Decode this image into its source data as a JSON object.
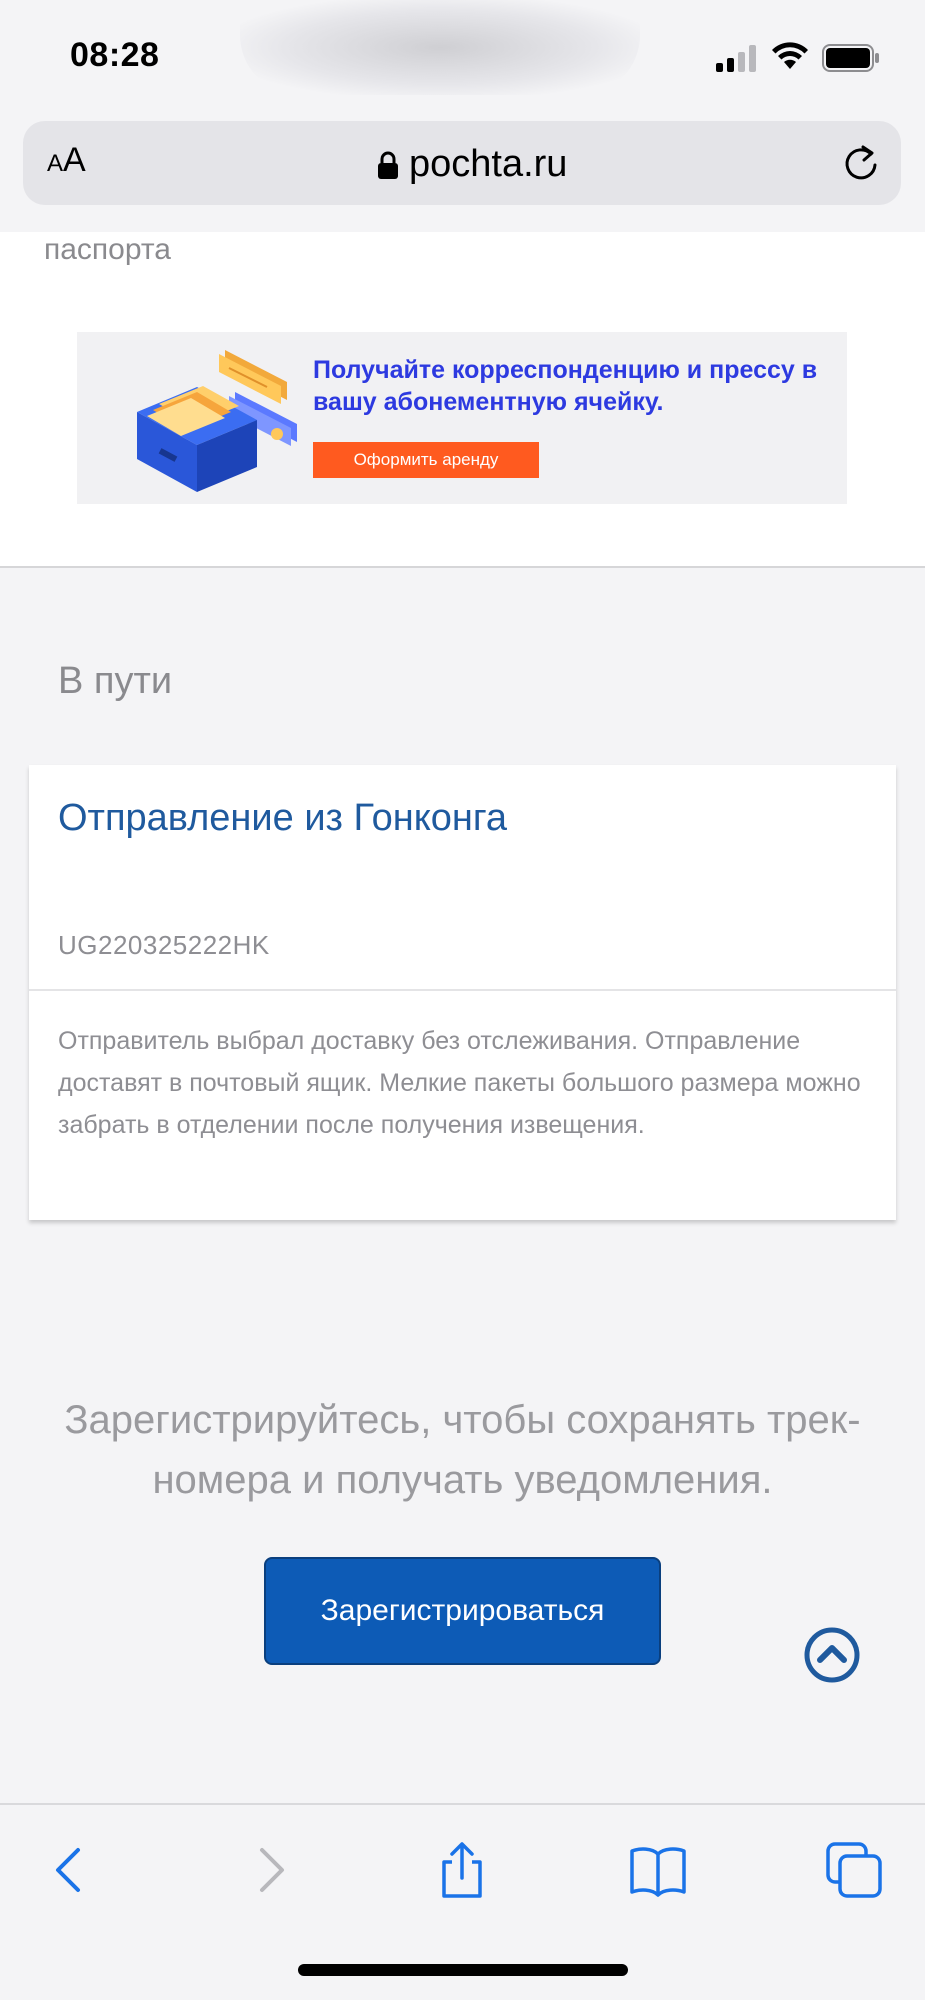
{
  "status_bar": {
    "time": "08:28"
  },
  "browser": {
    "text_size_label_small": "A",
    "text_size_label_large": "A",
    "host": "pochta.ru"
  },
  "page": {
    "passport_text": "паспорта",
    "banner": {
      "text": "Получайте корреспонденцию и прессу в вашу абонементную ячейку.",
      "button_label": "Оформить аренду"
    },
    "in_transit_title": "В пути",
    "shipment": {
      "title": "Отправление из Гонконга",
      "track_number": "UG220325222HK",
      "note": "Отправитель выбрал доставку без отслеживания. Отправление доставят в почтовый ящик. Мелкие пакеты большого размера можно забрать в отделении после получения извещения."
    },
    "register": {
      "text": "Зарегистрируйтесь, чтобы сохранять трек-номера и получать уведомления.",
      "button_label": "Зарегистрироваться"
    }
  },
  "colors": {
    "link_blue": "#1f5a9e",
    "button_blue": "#0d5bb6",
    "banner_text": "#2d3ae0",
    "banner_button": "#ff5a1f",
    "ios_blue": "#1a73e8"
  },
  "icons": [
    "lock-icon",
    "reload-icon",
    "scroll-top-icon",
    "back-icon",
    "forward-icon",
    "share-icon",
    "bookmarks-icon",
    "tabs-icon"
  ]
}
